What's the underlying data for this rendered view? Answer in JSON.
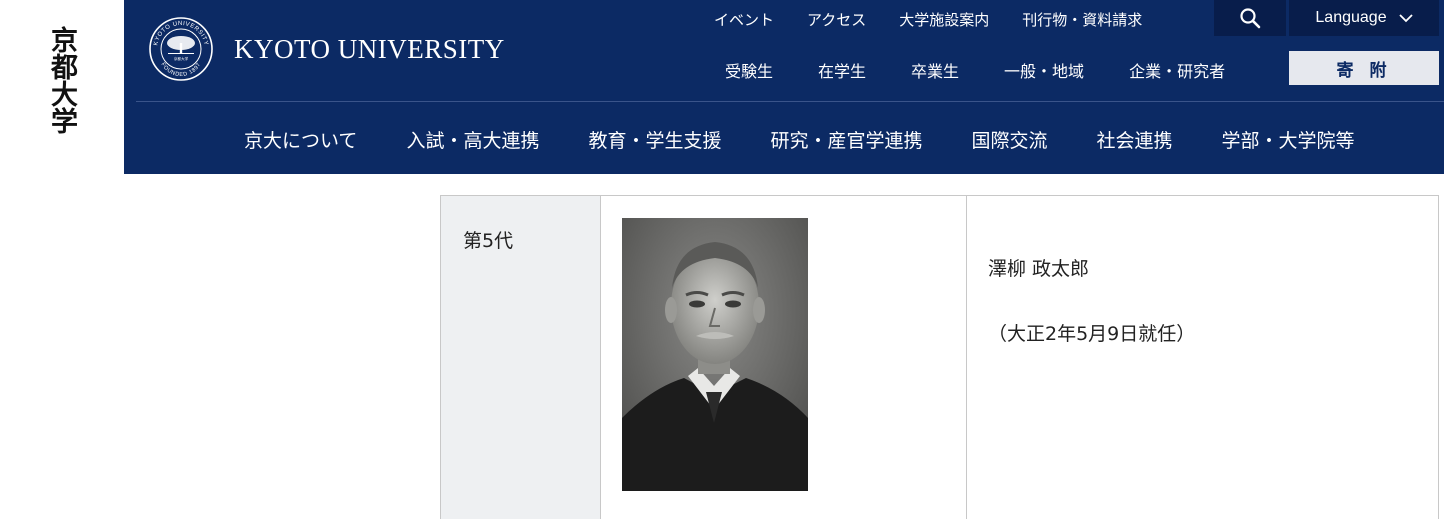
{
  "side_logo": {
    "text": "京都大学"
  },
  "header": {
    "brand_name": "KYOTO UNIVERSITY",
    "emblem_ring_top": "KYOTO UNIVERSITY",
    "emblem_ring_bottom": "FOUNDED 1897",
    "emblem_center": "京都大学",
    "top_links": [
      "イベント",
      "アクセス",
      "大学施設案内",
      "刊行物・資料請求"
    ],
    "search_icon": "search-icon",
    "language_label": "Language",
    "second_links": [
      "受験生",
      "在学生",
      "卒業生",
      "一般・地域",
      "企業・研究者"
    ],
    "donate_label": "寄 附",
    "main_nav": [
      "京大について",
      "入試・高大連携",
      "教育・学生支援",
      "研究・産官学連携",
      "国際交流",
      "社会連携",
      "学部・大学院等"
    ],
    "colors": {
      "navy": "#0c2a64",
      "navy_dark": "#081d4b",
      "donate_bg": "#e6e8ee"
    }
  },
  "president": {
    "generation": "第5代",
    "name": "澤柳 政太郎",
    "appointed": "（大正2年5月9日就任）"
  }
}
